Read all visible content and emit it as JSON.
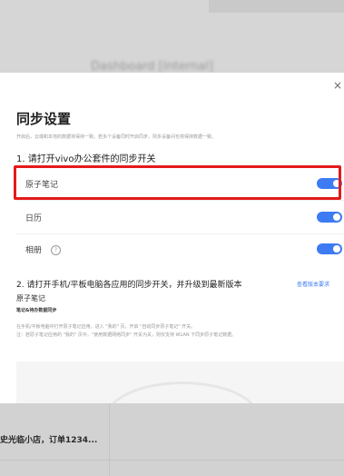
{
  "background": {
    "ghost_title": "Dashboard [Internal]",
    "shop_text": "史光临小店，订单1234..."
  },
  "dialog": {
    "close_label": "×",
    "title": "同步设置",
    "subtitle": "开启后，云端和本地的数据将保持一致。若多个设备同时开启同步，则多设备间也将保持数据一致。",
    "section1_title": "1. 请打开vivo办公套件的同步开关",
    "settings": [
      {
        "label": "原子笔记",
        "on": true
      },
      {
        "label": "日历",
        "on": true
      },
      {
        "label": "相册",
        "on": true
      }
    ],
    "help_glyph": "?",
    "section2_title": "2. 请打开手机/平板电脑各应用的同步开关，并升级到最新版本",
    "section2_link": "查看版本要求",
    "app_name": "原子笔记",
    "app_sub": "笔记&待办数据同步",
    "desc_lines": [
      "在手机/平板电脑中打开原子笔记应用，进入 \"我的\" 页，开启 \"自动同步原子笔记\" 开关。",
      "注：若原子笔记应用的 \"我的\" 页中，\"使用数据网络同步\" 开关为关，则仅支持 WLAN 下同步原子笔记数据。"
    ]
  },
  "colors": {
    "accent": "#3d7bf2",
    "highlight": "#e41a1a"
  }
}
